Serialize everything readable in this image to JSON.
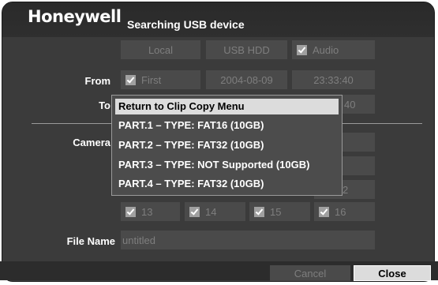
{
  "brand": "Honeywell",
  "dialog_title": "Searching USB device",
  "header_cells": {
    "local": "Local",
    "usb_hdd": "USB HDD",
    "audio": "Audio"
  },
  "from": {
    "label": "From",
    "first": "First",
    "date": "2004-08-09",
    "time": "23:33:40"
  },
  "to": {
    "label": "To",
    "time_partial": "40"
  },
  "camera": {
    "label": "Camera",
    "partial_value": "2"
  },
  "camera_checks": [
    "13",
    "14",
    "15",
    "16"
  ],
  "file_name": {
    "label": "File Name",
    "placeholder": "untitled"
  },
  "popup": {
    "items": [
      "Return to Clip Copy Menu",
      "PART.1 – TYPE: FAT16 (10GB)",
      "PART.2 – TYPE: FAT32 (10GB)",
      "PART.3 – TYPE: NOT Supported (10GB)",
      "PART.4 – TYPE: FAT32 (10GB)"
    ],
    "selected_index": 0
  },
  "buttons": {
    "cancel": "Cancel",
    "close": "Close"
  }
}
